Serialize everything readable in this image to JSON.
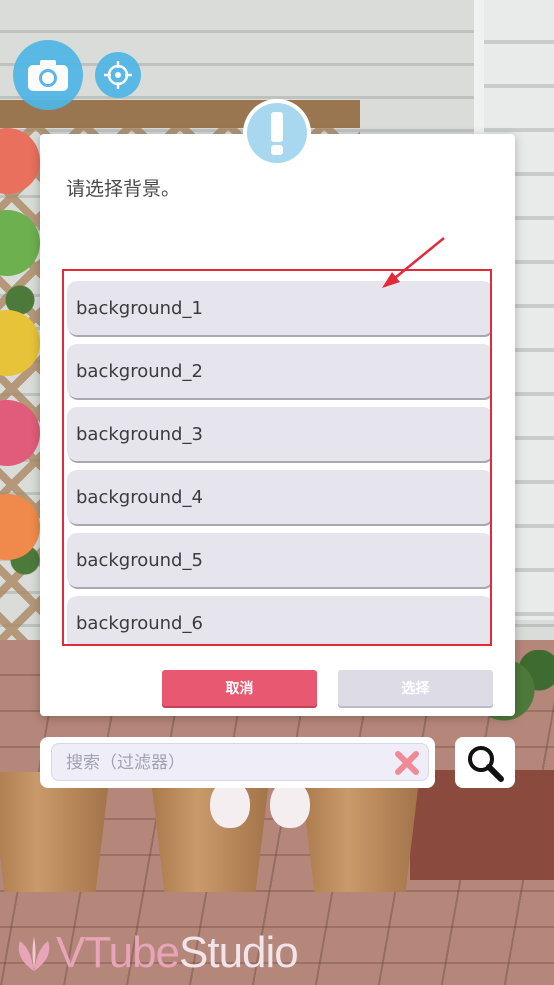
{
  "dialog": {
    "prompt": "请选择背景。",
    "items": [
      {
        "label": "background_1"
      },
      {
        "label": "background_2"
      },
      {
        "label": "background_3"
      },
      {
        "label": "background_4"
      },
      {
        "label": "background_5"
      },
      {
        "label": "background_6"
      }
    ],
    "cancel_label": "取消",
    "select_label": "选择"
  },
  "search": {
    "placeholder": "搜索（过滤器）",
    "value": ""
  },
  "logo": {
    "part1": "VTube",
    "part2": "Studio"
  },
  "colors": {
    "accent_pink": "#e85870",
    "highlight_red": "#e22a3a",
    "info_blue": "#a8d8f0",
    "camera_blue": "#4fb6e6"
  },
  "icons": [
    "camera-icon",
    "crosshair-icon",
    "exclamation-icon",
    "arrow-icon",
    "clear-icon",
    "search-icon",
    "logo-icon"
  ]
}
